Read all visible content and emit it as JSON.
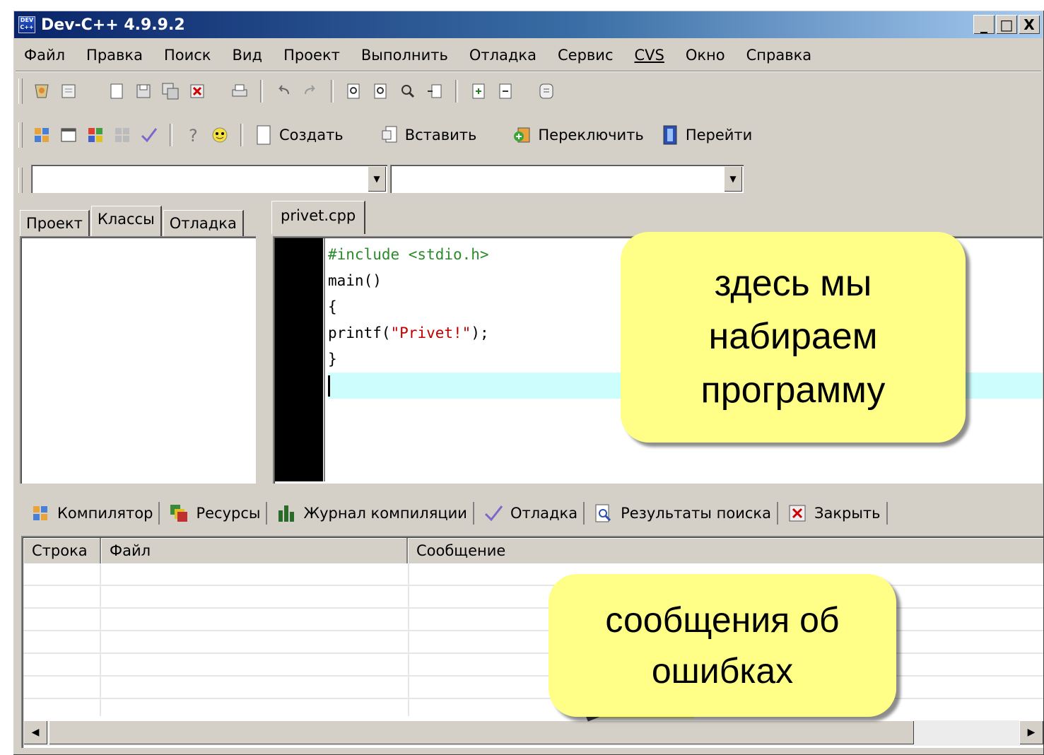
{
  "window": {
    "title": "Dev-C++ 4.9.9.2",
    "controls": [
      "_",
      "□",
      "X"
    ]
  },
  "menu": [
    "Файл",
    "Правка",
    "Поиск",
    "Вид",
    "Проект",
    "Выполнить",
    "Отладка",
    "Сервис",
    "CVS",
    "Окно",
    "Справка"
  ],
  "toolbar": {
    "create_label": "Создать",
    "insert_label": "Вставить",
    "toggle_label": "Переключить",
    "goto_label": "Перейти"
  },
  "left_tabs": [
    "Проект",
    "Классы",
    "Отладка"
  ],
  "editor": {
    "file_tab": "privet.cpp",
    "code": {
      "line1": "#include <stdio.h>",
      "line2": "main()",
      "line3": "{",
      "line4_fn": "printf(",
      "line4_str": "\"Privet!\"",
      "line4_end": ");",
      "line5": "}"
    }
  },
  "bottom_tabs": [
    "Компилятор",
    "Ресурсы",
    "Журнал компиляции",
    "Отладка",
    "Результаты поиска",
    "Закрыть"
  ],
  "grid": {
    "headers": [
      "Строка",
      "Файл",
      "Сообщение"
    ]
  },
  "callouts": {
    "editor_line1": "здесь мы",
    "editor_line2": "набираем",
    "editor_line3": "программу",
    "errors_line1": "сообщения об",
    "errors_line2": "ошибках"
  },
  "colors": {
    "callout": "#ffff88",
    "current_line": "#cdfdfc",
    "titlebar_start": "#0a246a",
    "titlebar_end": "#a6caf0"
  }
}
